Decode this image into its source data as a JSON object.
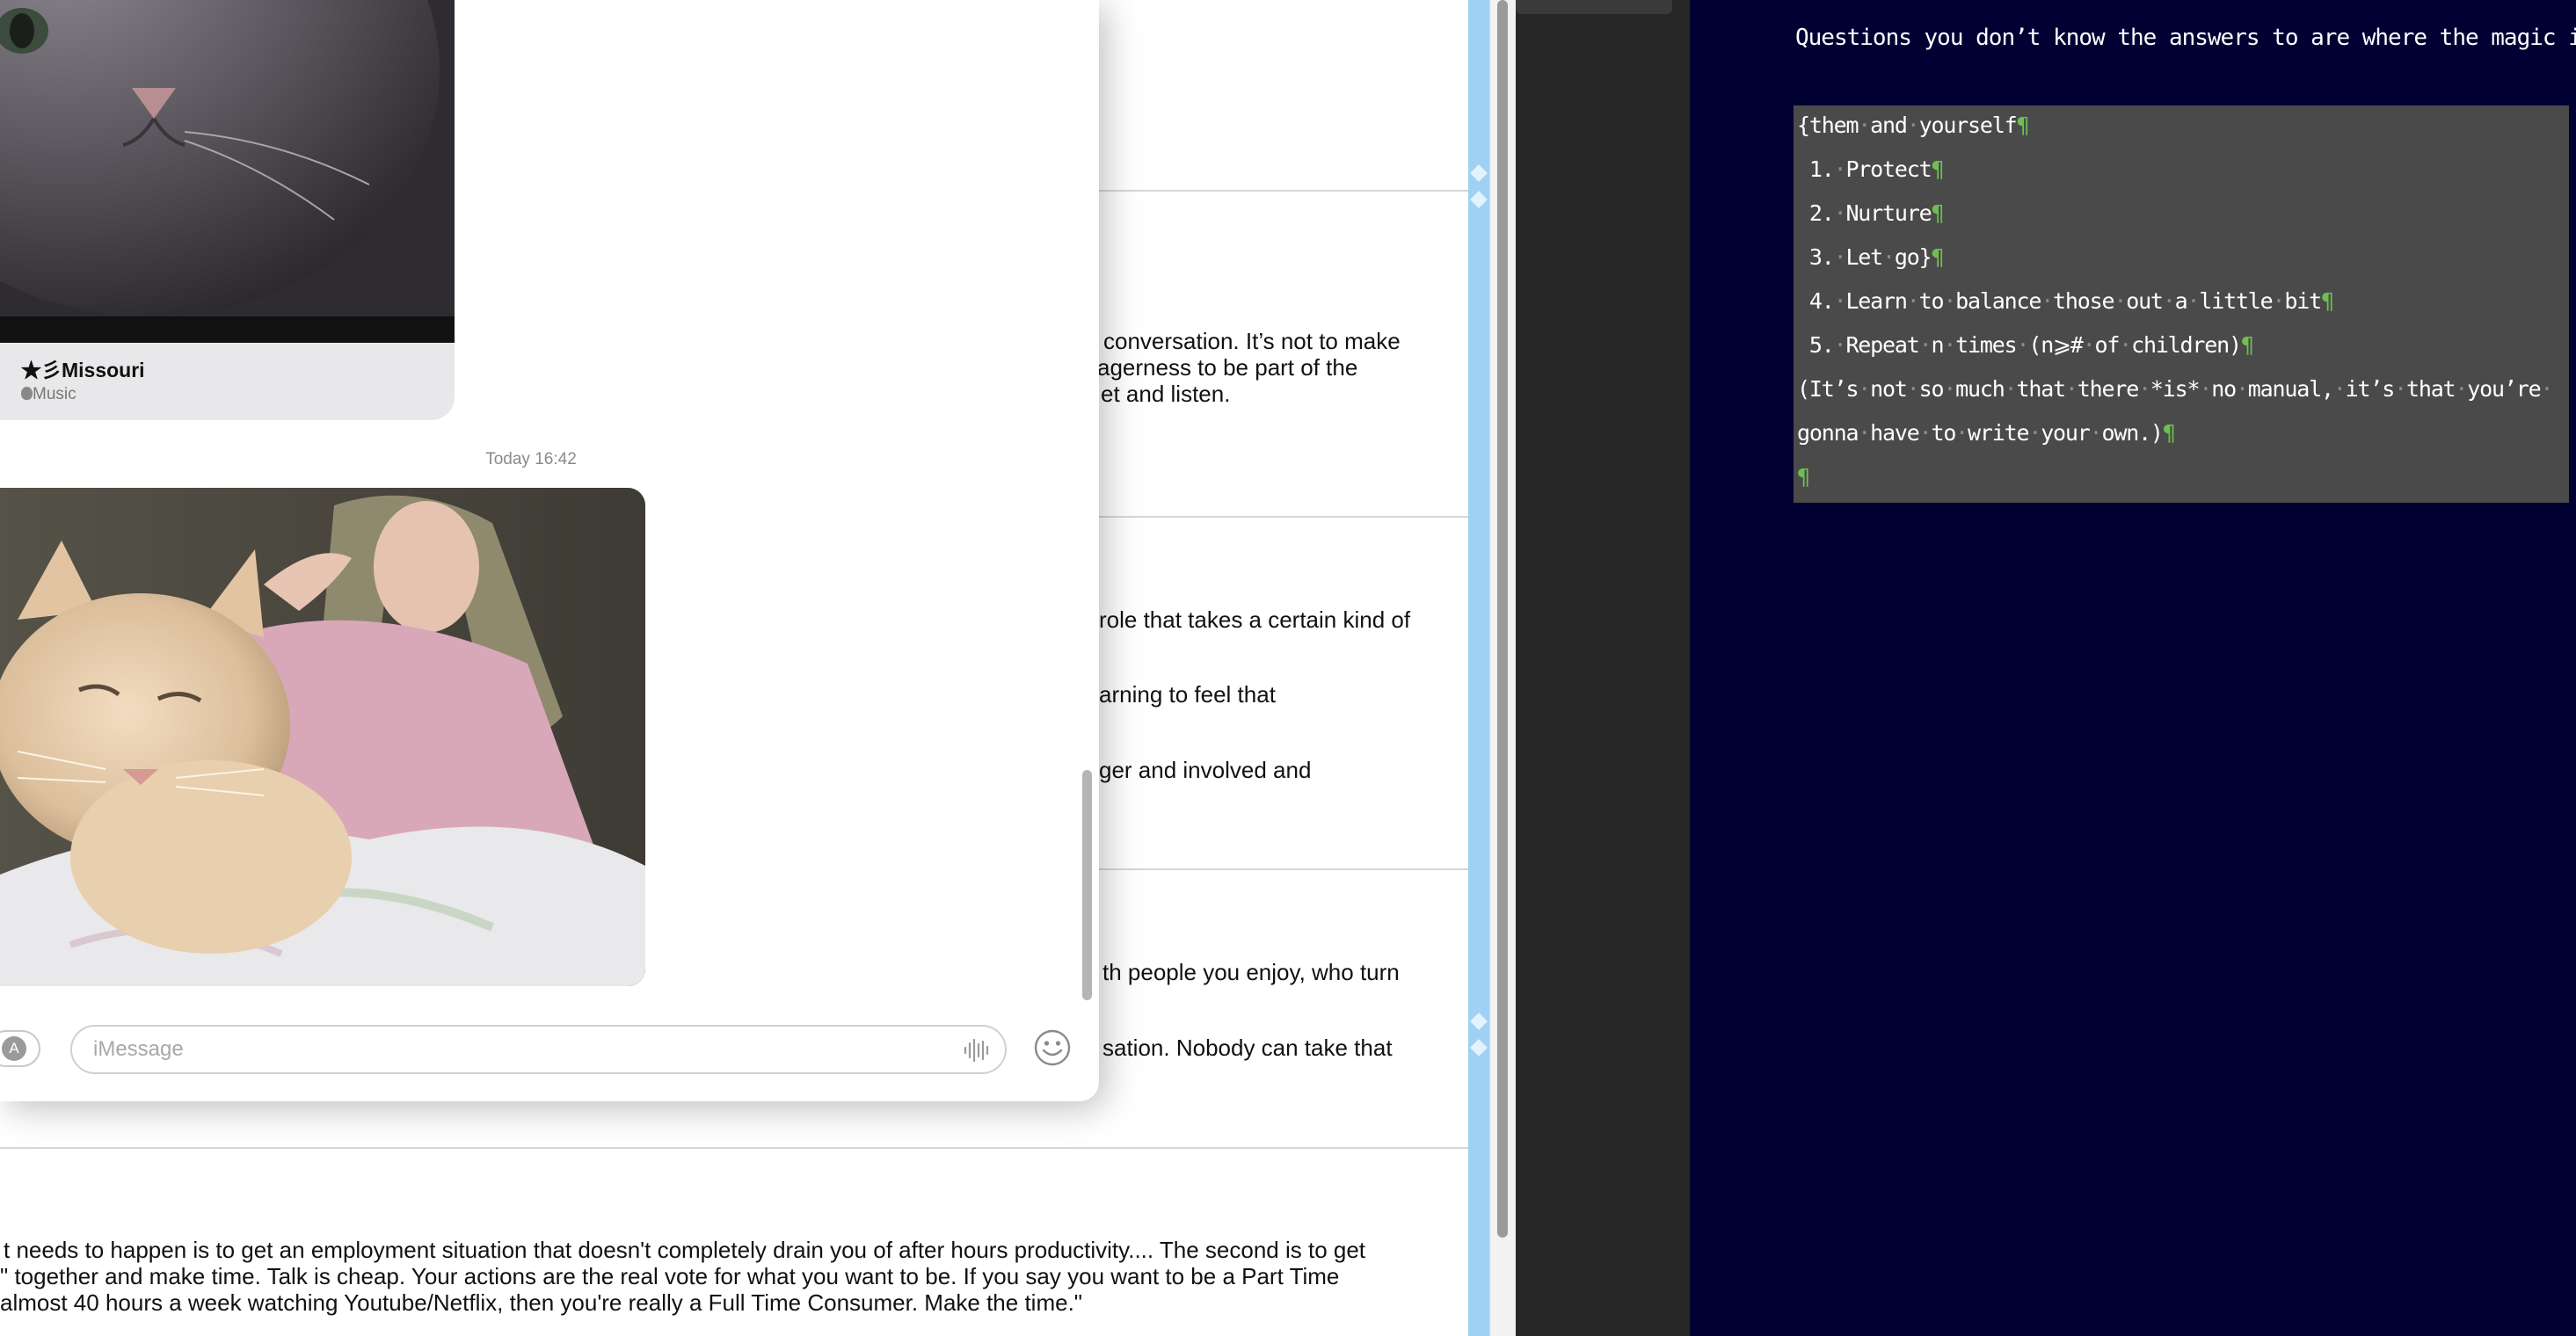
{
  "background_document": {
    "paragraphs": [
      {
        "lines": [
          "conversation. It’s not to make",
          "agerness to be part of the",
          "et and listen."
        ]
      },
      {
        "lines": [
          "role that takes a certain kind of",
          "arning to feel that",
          "ger and involved and"
        ]
      },
      {
        "lines": [
          "th people you enjoy, who turn",
          "sation. Nobody can take that"
        ]
      },
      {
        "lines": [
          "t needs to happen is to get an employment situation that doesn't completely drain you of after hours productivity.... The second is to get",
          "\" together and make time. Talk is cheap. Your actions are the real vote for what you want to be. If you say you want to be a Part Time",
          " almost 40 hours a week watching Youtube/Netflix, then you're really a Full Time Consumer. Make the time.\""
        ]
      }
    ]
  },
  "messages": {
    "music_card": {
      "title": "★彡Missouri",
      "subtitle": "Music",
      "apple_icon": "apple-logo-icon"
    },
    "timestamp": "Today 16:42",
    "input": {
      "placeholder": "iMessage",
      "value": ""
    },
    "icons": {
      "app_store": "app-store-icon",
      "audio": "audio-waveform-icon",
      "emoji": "emoji-icon"
    }
  },
  "editor": {
    "heading": "Questions you don’t know the answers to are where the magic is",
    "block_lines": [
      {
        "text": "{them·and·yourself",
        "mark": "¶"
      },
      {
        "text": " 1.·Protect",
        "mark": "¶"
      },
      {
        "text": " 2.·Nurture",
        "mark": "¶"
      },
      {
        "text": " 3.·Let·go}",
        "mark": "¶"
      },
      {
        "text": " 4.·Learn·to·balance·those·out·a·little·bit",
        "mark": "¶"
      },
      {
        "text": " 5.·Repeat·n·times·(n⩾#·of·children)",
        "mark": "¶"
      },
      {
        "text": "(It’s·not·so·much·that·there·*is*·no·manual,·it’s·that·you’re·",
        "mark": ""
      },
      {
        "text": "gonna·have·to·write·your·own.)",
        "mark": "¶"
      },
      {
        "text": "",
        "mark": "¶"
      }
    ],
    "colors": {
      "background": "#000033",
      "pilcrow": "#6fbf4f",
      "selection": "#4a4a4a"
    }
  }
}
